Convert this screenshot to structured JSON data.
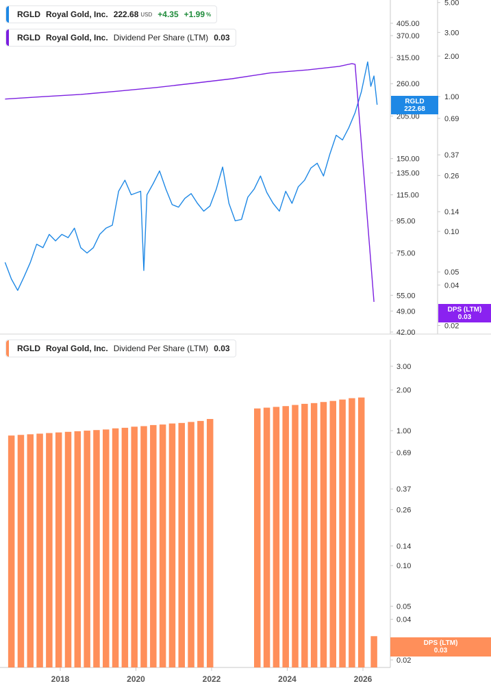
{
  "colors": {
    "price_line": "#1e88e5",
    "dps_line": "#7b1fe0",
    "dps_bar": "#ff8f5a",
    "price_tag_bg": "#1e88e5",
    "dps_tag_top_bg": "#8a22f0",
    "dps_tag_bottom_bg": "#ff8f5a",
    "grid_axis": "#c8c8c8",
    "tick_text": "#333333",
    "positive_change": "#1e8b3a"
  },
  "legends": {
    "top": {
      "symbol": "RGLD",
      "company": "Royal Gold, Inc.",
      "price": "222.68",
      "currency": "USD",
      "change": "+4.35",
      "change_pct": "+1.99",
      "pct_sign": "%"
    },
    "middle": {
      "symbol": "RGLD",
      "company": "Royal Gold, Inc.",
      "metric": "Dividend Per Share (LTM)",
      "value": "0.03"
    },
    "bottom": {
      "symbol": "RGLD",
      "company": "Royal Gold, Inc.",
      "metric": "Dividend Per Share (LTM)",
      "value": "0.03"
    }
  },
  "tags": {
    "price": {
      "label": "RGLD",
      "value": "222.68"
    },
    "dps_top": {
      "label": "DPS (LTM)",
      "value": "0.03"
    },
    "dps_bottom": {
      "label": "DPS (LTM)",
      "value": "0.03"
    }
  },
  "chart_data": [
    {
      "type": "line",
      "x_ticks": [
        "2018",
        "2020",
        "2022",
        "2024",
        "2026"
      ],
      "price_axis": {
        "scale": "log",
        "ticks": [
          "405.00",
          "370.00",
          "315.00",
          "260.00",
          "205.00",
          "150.00",
          "135.00",
          "115.00",
          "95.00",
          "75.00",
          "55.00",
          "49.00",
          "42.00"
        ]
      },
      "dps_axis": {
        "scale": "log",
        "ticks": [
          "5.00",
          "3.00",
          "2.00",
          "1.00",
          "0.69",
          "0.37",
          "0.26",
          "0.14",
          "0.10",
          "0.05",
          "0.04",
          "0.02"
        ]
      },
      "series": [
        {
          "name": "RGLD",
          "axis": "price",
          "points": [
            [
              "2016-07",
              70
            ],
            [
              "2016-09",
              62
            ],
            [
              "2016-11",
              57
            ],
            [
              "2017-01",
              63
            ],
            [
              "2017-03",
              70
            ],
            [
              "2017-05",
              80
            ],
            [
              "2017-07",
              78
            ],
            [
              "2017-09",
              86
            ],
            [
              "2017-11",
              82
            ],
            [
              "2018-01",
              86
            ],
            [
              "2018-03",
              84
            ],
            [
              "2018-05",
              90
            ],
            [
              "2018-07",
              78
            ],
            [
              "2018-09",
              75
            ],
            [
              "2018-11",
              78
            ],
            [
              "2019-01",
              86
            ],
            [
              "2019-03",
              90
            ],
            [
              "2019-05",
              92
            ],
            [
              "2019-07",
              118
            ],
            [
              "2019-09",
              128
            ],
            [
              "2019-11",
              115
            ],
            [
              "2020-01",
              117
            ],
            [
              "2020-02",
              118
            ],
            [
              "2020-03",
              66
            ],
            [
              "2020-04",
              115
            ],
            [
              "2020-06",
              125
            ],
            [
              "2020-08",
              137
            ],
            [
              "2020-10",
              120
            ],
            [
              "2020-12",
              107
            ],
            [
              "2021-02",
              105
            ],
            [
              "2021-04",
              112
            ],
            [
              "2021-06",
              116
            ],
            [
              "2021-08",
              108
            ],
            [
              "2021-10",
              102
            ],
            [
              "2021-12",
              106
            ],
            [
              "2022-02",
              120
            ],
            [
              "2022-04",
              141
            ],
            [
              "2022-06",
              108
            ],
            [
              "2022-08",
              95
            ],
            [
              "2022-10",
              96
            ],
            [
              "2022-12",
              113
            ],
            [
              "2023-02",
              120
            ],
            [
              "2023-04",
              132
            ],
            [
              "2023-06",
              117
            ],
            [
              "2023-08",
              108
            ],
            [
              "2023-10",
              102
            ],
            [
              "2023-12",
              118
            ],
            [
              "2024-02",
              108
            ],
            [
              "2024-04",
              122
            ],
            [
              "2024-06",
              128
            ],
            [
              "2024-08",
              140
            ],
            [
              "2024-10",
              145
            ],
            [
              "2024-12",
              132
            ],
            [
              "2025-02",
              155
            ],
            [
              "2025-04",
              178
            ],
            [
              "2025-06",
              172
            ],
            [
              "2025-08",
              188
            ],
            [
              "2025-10",
              210
            ],
            [
              "2025-12",
              245
            ],
            [
              "2026-02",
              305
            ],
            [
              "2026-03",
              255
            ],
            [
              "2026-04",
              275
            ],
            [
              "2026-05",
              222.68
            ]
          ]
        },
        {
          "name": "Dividend Per Share (LTM)",
          "axis": "dps",
          "points": [
            [
              "2016-07",
              0.96
            ],
            [
              "2017-07",
              1.0
            ],
            [
              "2018-07",
              1.04
            ],
            [
              "2019-07",
              1.1
            ],
            [
              "2020-07",
              1.17
            ],
            [
              "2021-07",
              1.26
            ],
            [
              "2022-07",
              1.36
            ],
            [
              "2023-07",
              1.5
            ],
            [
              "2024-07",
              1.58
            ],
            [
              "2025-05",
              1.68
            ],
            [
              "2025-09",
              1.76
            ],
            [
              "2025-10",
              1.74
            ],
            [
              "2026-04",
              0.03
            ]
          ]
        }
      ]
    },
    {
      "type": "bar",
      "series": [
        {
          "name": "Dividend Per Share (LTM)",
          "points": [
            [
              "2016-09",
              0.92
            ],
            [
              "2016-12",
              0.93
            ],
            [
              "2017-03",
              0.94
            ],
            [
              "2017-06",
              0.95
            ],
            [
              "2017-09",
              0.96
            ],
            [
              "2017-12",
              0.97
            ],
            [
              "2018-03",
              0.98
            ],
            [
              "2018-06",
              0.99
            ],
            [
              "2018-09",
              1.0
            ],
            [
              "2018-12",
              1.01
            ],
            [
              "2019-03",
              1.02
            ],
            [
              "2019-06",
              1.04
            ],
            [
              "2019-09",
              1.05
            ],
            [
              "2019-12",
              1.07
            ],
            [
              "2020-03",
              1.08
            ],
            [
              "2020-06",
              1.1
            ],
            [
              "2020-09",
              1.11
            ],
            [
              "2020-12",
              1.13
            ],
            [
              "2021-03",
              1.14
            ],
            [
              "2021-06",
              1.16
            ],
            [
              "2021-09",
              1.18
            ],
            [
              "2021-12",
              1.22
            ],
            [
              "2023-03",
              1.46
            ],
            [
              "2023-06",
              1.48
            ],
            [
              "2023-09",
              1.5
            ],
            [
              "2023-12",
              1.52
            ],
            [
              "2024-03",
              1.55
            ],
            [
              "2024-06",
              1.58
            ],
            [
              "2024-09",
              1.6
            ],
            [
              "2024-12",
              1.63
            ],
            [
              "2025-03",
              1.66
            ],
            [
              "2025-06",
              1.7
            ],
            [
              "2025-09",
              1.74
            ],
            [
              "2025-12",
              1.76
            ],
            [
              "2026-04",
              0.03
            ]
          ]
        }
      ],
      "x_ticks": [
        "2018",
        "2020",
        "2022",
        "2024",
        "2026"
      ],
      "y_axis": {
        "scale": "log",
        "ticks": [
          "3.00",
          "2.00",
          "1.00",
          "0.69",
          "0.37",
          "0.26",
          "0.14",
          "0.10",
          "0.05",
          "0.04",
          "0.02"
        ]
      }
    }
  ]
}
